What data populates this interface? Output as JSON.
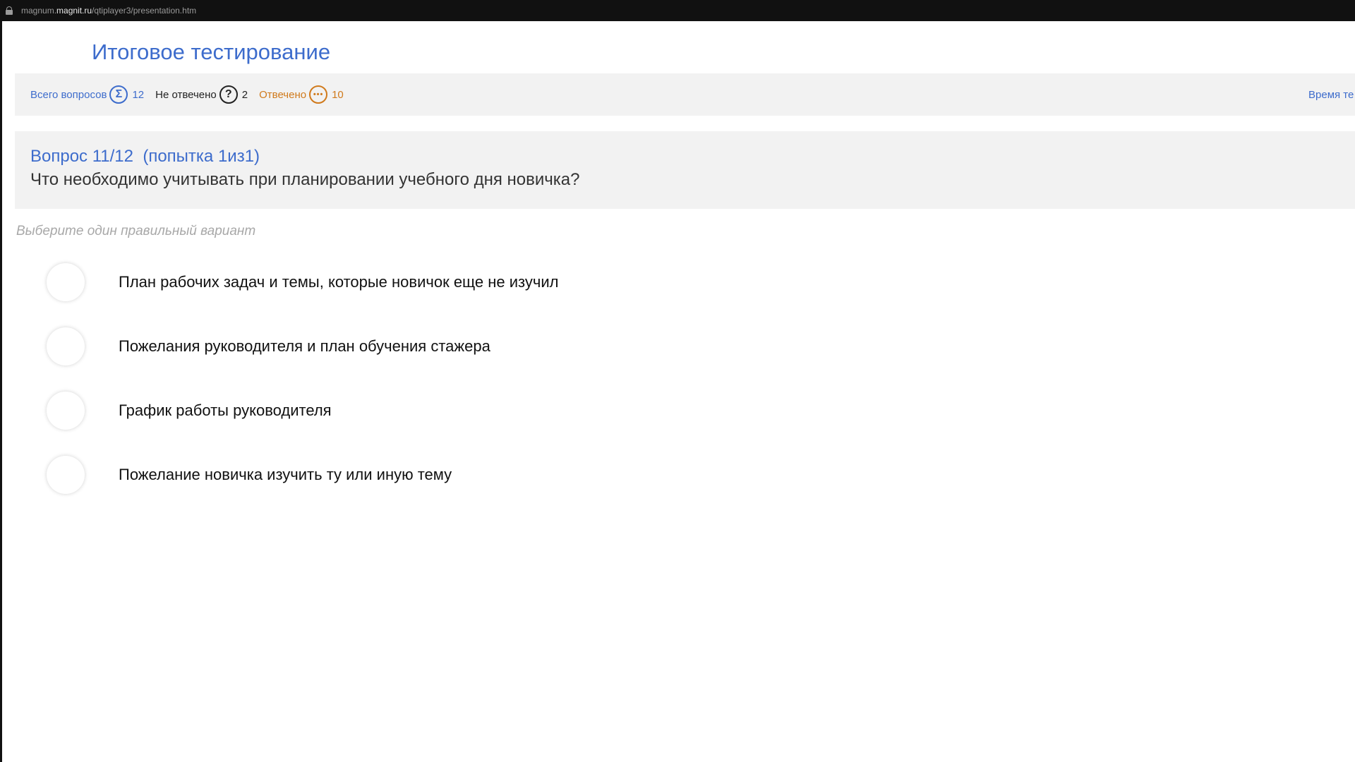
{
  "browser": {
    "url_prefix": "magnum.",
    "url_host": "magnit.ru",
    "url_path": "/qtiplayer3/presentation.htm"
  },
  "header": {
    "title": "Итоговое тестирование"
  },
  "stats": {
    "total_label": "Всего вопросов",
    "total_count": "12",
    "unanswered_label": "Не отвечено",
    "unanswered_count": "2",
    "answered_label": "Отвечено",
    "answered_count": "10",
    "timer_label": "Время те"
  },
  "icons": {
    "total": "sigma-icon",
    "unanswered": "question-icon",
    "answered": "dots-icon"
  },
  "question": {
    "number": "Вопрос 11/12  (попытка 1из1)",
    "text": "Что необходимо учитывать при планировании учебного дня новичка?",
    "instruction": "Выберите один правильный вариант"
  },
  "options": [
    {
      "label": "План рабочих задач и темы, которые новичок еще не изучил"
    },
    {
      "label": "Пожелания руководителя и план обучения стажера"
    },
    {
      "label": "График работы руководителя"
    },
    {
      "label": "Пожелание новичка изучить ту или иную тему"
    }
  ],
  "colors": {
    "accent": "#3d6ccc",
    "answered": "#d07a1c",
    "panel_bg": "#f2f2f2"
  }
}
